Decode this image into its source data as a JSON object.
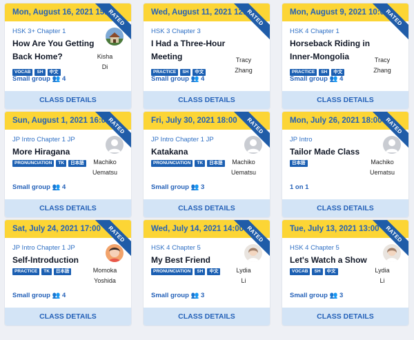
{
  "classes": [
    {
      "date": "Mon, August 16, 2021 15:00",
      "status": "RATED",
      "chapter": "HSK 3+ Chapter 1",
      "title": "How Are You Getting Back Home?",
      "tags": [
        "VOCAB",
        "SH",
        "中文"
      ],
      "teacher": [
        "Kisha",
        "Di"
      ],
      "avatar": "photo-house",
      "group": "Small group 👥 4",
      "details": "CLASS DETAILS"
    },
    {
      "date": "Wed, August 11, 2021 12:00",
      "status": "RATED",
      "chapter": "HSK 3 Chapter 3",
      "title": "I Had a Three-Hour Meeting",
      "tags": [
        "PRACTICE",
        "SH",
        "中文"
      ],
      "teacher": [
        "Tracy",
        "Zhang"
      ],
      "avatar": "",
      "group": "Small group 👥 4",
      "details": "CLASS DETAILS"
    },
    {
      "date": "Mon, August 9, 2021 10:00",
      "status": "RATED",
      "chapter": "HSK 4 Chapter 1",
      "title": "Horseback Riding in Inner-Mongolia",
      "tags": [
        "PRACTICE",
        "SH",
        "中文"
      ],
      "teacher": [
        "Tracy",
        "Zhang"
      ],
      "avatar": "",
      "group": "Small group 👥 4",
      "details": "CLASS DETAILS"
    },
    {
      "date": "Sun, August 1, 2021 16:00",
      "status": "RATED",
      "chapter": "JP Intro Chapter 1 JP",
      "title": "More Hiragana",
      "tags": [
        "PRONUNCIATION",
        "TK",
        "日本語"
      ],
      "teacher": [
        "Machiko",
        "Uematsu"
      ],
      "avatar": "placeholder",
      "group": "Small group 👥 4",
      "details": "CLASS DETAILS"
    },
    {
      "date": "Fri, July 30, 2021 18:00",
      "status": "RATED",
      "chapter": "JP Intro Chapter 1 JP",
      "title": "Katakana",
      "tags": [
        "PRONUNCIATION",
        "TK",
        "日本語"
      ],
      "teacher": [
        "Machiko",
        "Uematsu"
      ],
      "avatar": "placeholder",
      "group": "Small group 👥 3",
      "details": "CLASS DETAILS"
    },
    {
      "date": "Mon, July 26, 2021 18:00",
      "status": "RATED",
      "chapter": "JP Intro",
      "title": "Tailor Made Class",
      "tags": [
        "日本語"
      ],
      "teacher": [
        "Machiko",
        "Uematsu"
      ],
      "avatar": "placeholder",
      "group": "1 on 1",
      "details": "CLASS DETAILS"
    },
    {
      "date": "Sat, July 24, 2021 17:00",
      "status": "RATED",
      "chapter": "JP Intro Chapter 1 JP",
      "title": "Self-Introduction",
      "tags": [
        "PRACTICE",
        "TK",
        "日本語"
      ],
      "teacher": [
        "Momoka",
        "Yoshida"
      ],
      "avatar": "photo-face",
      "group": "Small group 👥 4",
      "details": "CLASS DETAILS"
    },
    {
      "date": "Wed, July 14, 2021 14:00",
      "status": "RATED",
      "chapter": "HSK 4 Chapter 5",
      "title": "My Best Friend",
      "tags": [
        "PRONUNCIATION",
        "SH",
        "中文"
      ],
      "teacher": [
        "Lydia",
        "Li"
      ],
      "avatar": "photo-portrait",
      "group": "Small group 👥 3",
      "details": "CLASS DETAILS"
    },
    {
      "date": "Tue, July 13, 2021 13:00",
      "status": "RATED",
      "chapter": "HSK 4 Chapter 5",
      "title": "Let's Watch a Show",
      "tags": [
        "VOCAB",
        "SH",
        "中文"
      ],
      "teacher": [
        "Lydia",
        "Li"
      ],
      "avatar": "photo-portrait",
      "group": "Small group 👥 3",
      "details": "CLASS DETAILS"
    }
  ]
}
